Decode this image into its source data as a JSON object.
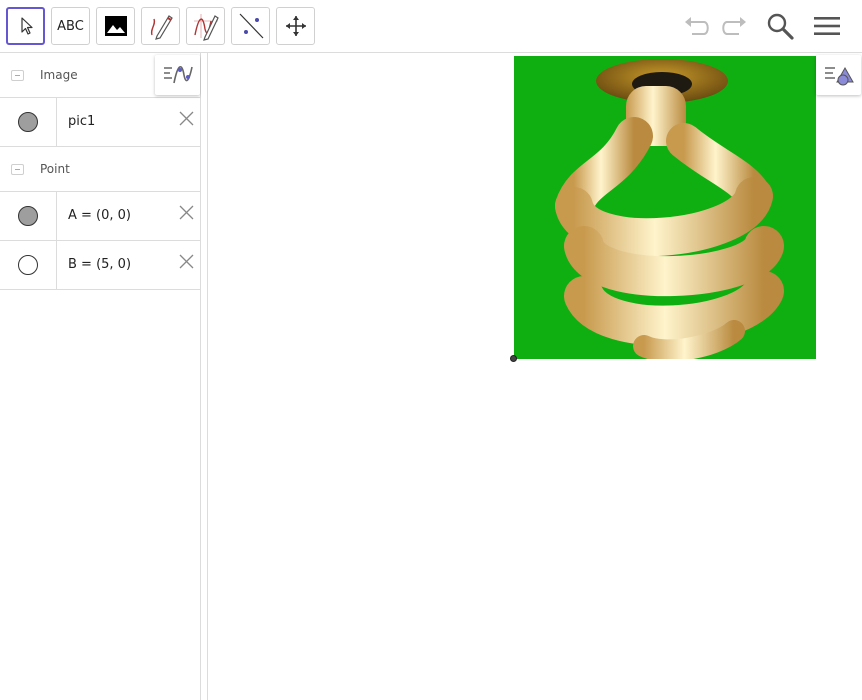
{
  "toolbar": {
    "tools": [
      {
        "name": "move-tool",
        "icon": "arrow-cursor-icon",
        "selected": true
      },
      {
        "name": "text-tool",
        "label": "ABC"
      },
      {
        "name": "image-tool",
        "icon": "image-icon"
      },
      {
        "name": "pen-tool",
        "icon": "pen-icon"
      },
      {
        "name": "freehand-function-tool",
        "icon": "freehand-function-icon"
      },
      {
        "name": "line-tool",
        "icon": "line-through-points-icon"
      },
      {
        "name": "move-graphics-view-tool",
        "icon": "move-arrows-icon"
      }
    ],
    "right": [
      "undo-icon",
      "redo-icon",
      "search-icon",
      "menu-icon"
    ]
  },
  "algebra": {
    "groups": [
      {
        "label": "Image",
        "items": [
          {
            "definition": "pic1",
            "marble": "filled"
          }
        ]
      },
      {
        "label": "Point",
        "items": [
          {
            "definition": "A = (0, 0)",
            "marble": "filled"
          },
          {
            "definition": "B = (5, 0)",
            "marble": "empty"
          }
        ]
      }
    ]
  },
  "graphics": {
    "picture_background": "#0faf12",
    "picture_subject": "spiral-bulb-image"
  },
  "colors": {
    "accent": "#6557d2",
    "border": "#dcdcdc",
    "picture_bg": "#0faf12"
  }
}
